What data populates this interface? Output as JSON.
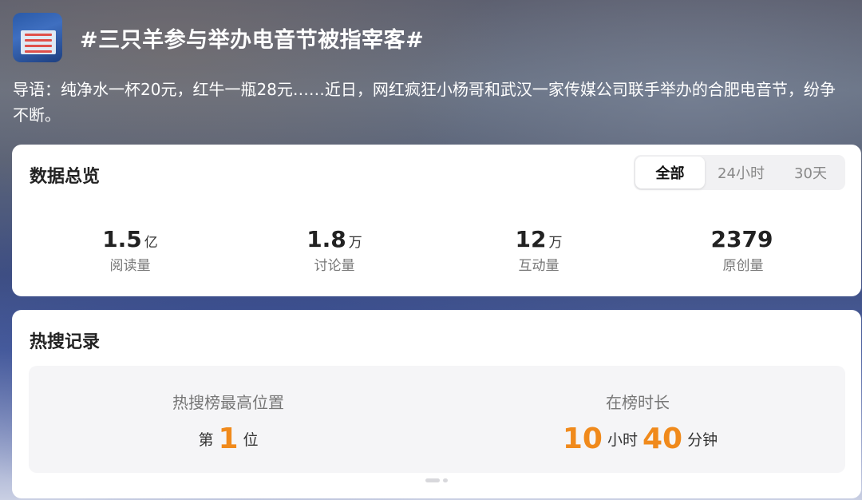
{
  "header": {
    "title": "#三只羊参与举办电音节被指宰客#",
    "guide": "导语：纯净水一杯20元，红牛一瓶28元……近日，网红疯狂小杨哥和武汉一家传媒公司联手举办的合肥电音节，纷争不断。"
  },
  "overview": {
    "title": "数据总览",
    "tabs": [
      {
        "label": "全部",
        "active": true
      },
      {
        "label": "24小时",
        "active": false
      },
      {
        "label": "30天",
        "active": false
      }
    ],
    "stats": [
      {
        "value": "1.5",
        "unit": "亿",
        "label": "阅读量"
      },
      {
        "value": "1.8",
        "unit": "万",
        "label": "讨论量"
      },
      {
        "value": "12",
        "unit": "万",
        "label": "互动量"
      },
      {
        "value": "2379",
        "unit": "",
        "label": "原创量"
      }
    ]
  },
  "hot_record": {
    "title": "热搜记录",
    "highest": {
      "label": "热搜榜最高位置",
      "prefix": "第",
      "rank": "1",
      "suffix": "位"
    },
    "duration": {
      "label": "在榜时长",
      "hours": "10",
      "hours_unit": "小时",
      "minutes": "40",
      "minutes_unit": "分钟"
    }
  },
  "colors": {
    "accent": "#f08a1c",
    "card_bg": "#ffffff",
    "panel_bg": "#f5f5f7"
  }
}
